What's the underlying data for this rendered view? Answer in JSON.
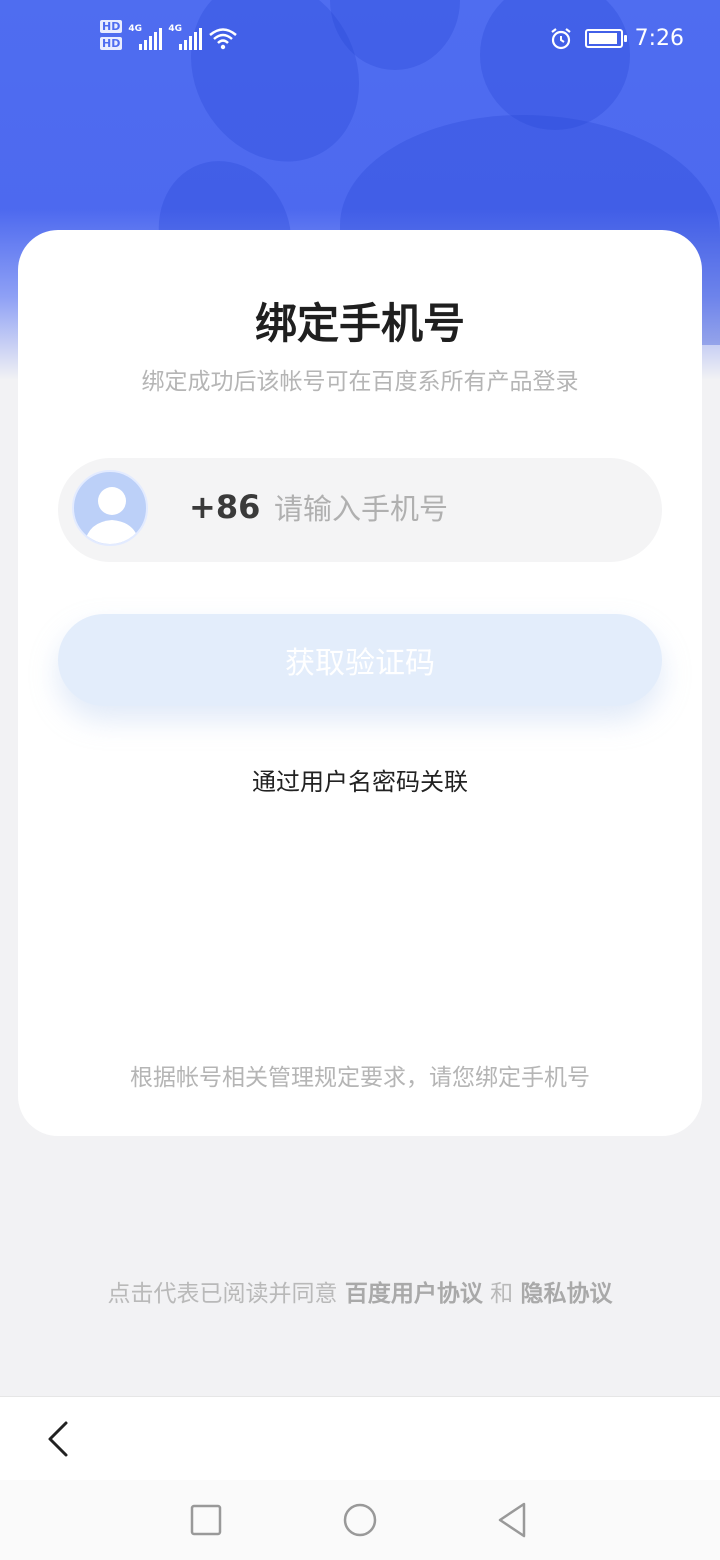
{
  "status_bar": {
    "time": "7:26",
    "sim1_label": "HD",
    "sim2_label": "HD",
    "network1": "4G",
    "network2": "4G",
    "icons": [
      "signal-icon",
      "wifi-icon",
      "alarm-icon",
      "battery-icon"
    ]
  },
  "card": {
    "title": "绑定手机号",
    "subtitle": "绑定成功后该帐号可在百度系所有产品登录",
    "country_code": "+86",
    "phone_placeholder": "请输入手机号",
    "get_code_label": "获取验证码",
    "alt_link_label": "通过用户名密码关联",
    "notice": "根据帐号相关管理规定要求，请您绑定手机号"
  },
  "agreement": {
    "prefix": "点击代表已阅读并同意",
    "user_agreement": "百度用户协议",
    "and": "和",
    "privacy": "隐私协议"
  },
  "colors": {
    "brand_blue": "#4f6df0",
    "button_disabled_bg": "#e3edfb",
    "card_bg": "#ffffff",
    "page_bg": "#f2f2f4"
  },
  "navigation": {
    "toolbar_icons": [
      "back-arrow-icon"
    ],
    "system_icons": [
      "recent-apps-icon",
      "home-icon",
      "back-triangle-icon"
    ]
  }
}
